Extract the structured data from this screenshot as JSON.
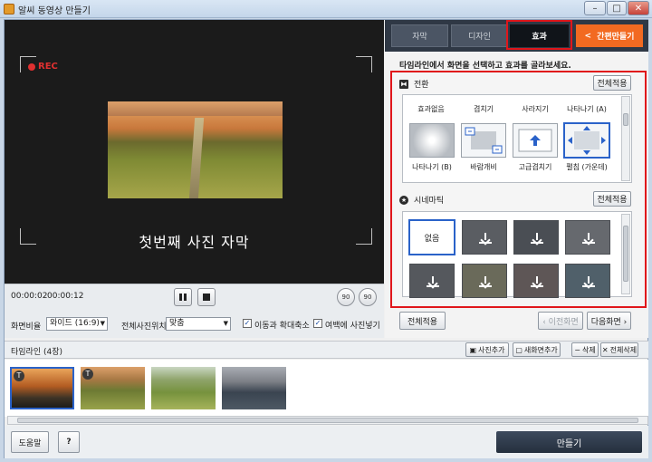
{
  "window": {
    "title": "알씨 동영상 만들기",
    "minimize": "–",
    "maximize": "□",
    "close": "✕"
  },
  "preview": {
    "rec_label": "REC",
    "caption": "첫번째 사진 자막"
  },
  "playback": {
    "current_time": "00:00:02",
    "total_time": "00:00:12",
    "rotate_left": "90",
    "rotate_right": "90"
  },
  "settings": {
    "aspect_label": "화면비율",
    "aspect_value": "와이드 (16:9)",
    "photo_position_label": "전체사진위치",
    "photo_position_value": "맞춤",
    "move_zoom_label": "이동과 확대축소",
    "move_zoom_checked": true,
    "margin_photo_label": "여백에 사진넣기",
    "margin_photo_checked": true
  },
  "tabs": {
    "subtitle": "자막",
    "design": "디자인",
    "effect": "효과",
    "quick_make": "간편만들기",
    "quick_arrow": "<"
  },
  "instruction": "타임라인에서 화면을 선택하고 효과를 골라보세요.",
  "transition": {
    "title": "전환",
    "apply_all": "전체적용",
    "top_row_labels": [
      "효과없음",
      "겹치기",
      "사라지기",
      "나타나기 (A)"
    ],
    "items": [
      {
        "label": "나타나기 (B)",
        "icon": "radial-fade"
      },
      {
        "label": "바람개비",
        "icon": "pinwheel"
      },
      {
        "label": "고급겹치기",
        "icon": "advanced-overlap"
      },
      {
        "label": "펼침 (가운데)",
        "icon": "expand-center",
        "selected": true
      }
    ]
  },
  "cinematic": {
    "title": "시네마틱",
    "apply_all": "전체적용",
    "items": [
      {
        "label": "없음",
        "selected": true
      },
      {
        "icon": "download"
      },
      {
        "icon": "download"
      },
      {
        "icon": "download"
      },
      {
        "icon": "download"
      },
      {
        "icon": "download"
      },
      {
        "icon": "download"
      },
      {
        "icon": "download"
      }
    ]
  },
  "nav": {
    "apply_all": "전체적용",
    "prev": "‹ 이전화면",
    "next": "다음화면 ›"
  },
  "timeline": {
    "label": "타임라인 (4장)",
    "add_photo": "사진추가",
    "add_screen": "새화면추가",
    "delete": "삭제",
    "delete_all": "전체삭제",
    "clips": [
      {
        "name": "sunset",
        "has_text": true,
        "badge": "T"
      },
      {
        "name": "field-path",
        "has_text": true,
        "badge": "T"
      },
      {
        "name": "grass-path",
        "has_text": false
      },
      {
        "name": "sea",
        "has_text": false
      }
    ]
  },
  "footer": {
    "help": "도움말",
    "question": "?",
    "make": "만들기"
  },
  "colors": {
    "accent_orange": "#f26a21",
    "highlight_red": "#e0161b",
    "selection_blue": "#2a62c9",
    "dark_panel": "#2f3845"
  }
}
